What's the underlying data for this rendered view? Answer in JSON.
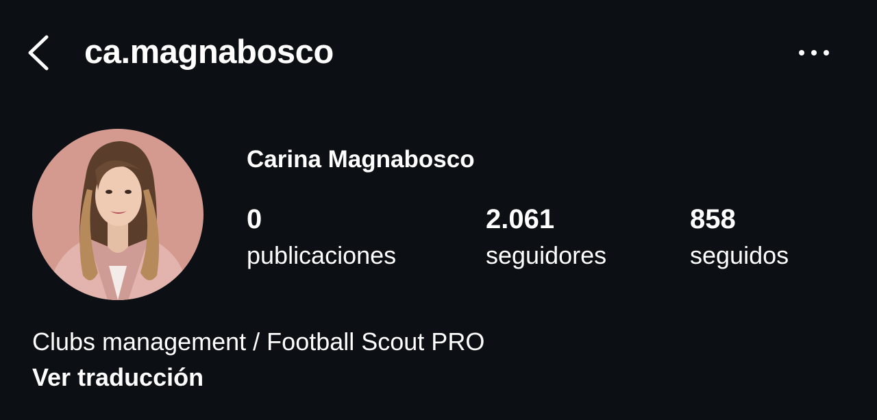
{
  "header": {
    "back_icon": "chevron-left-icon",
    "username": "ca.magnabosco",
    "more_icon": "more-horizontal-icon"
  },
  "profile": {
    "avatar_icon": "profile-photo",
    "display_name": "Carina Magnabosco",
    "stats": {
      "posts": {
        "count": "0",
        "label": "publicaciones"
      },
      "followers": {
        "count": "2.061",
        "label": "seguidores"
      },
      "following": {
        "count": "858",
        "label": "seguidos"
      }
    },
    "bio": "Clubs management / Football Scout PRO",
    "translate_link": "Ver traducción"
  },
  "colors": {
    "background": "#0c0f14",
    "text": "#ffffff",
    "avatar_background": "#d59a8f"
  }
}
